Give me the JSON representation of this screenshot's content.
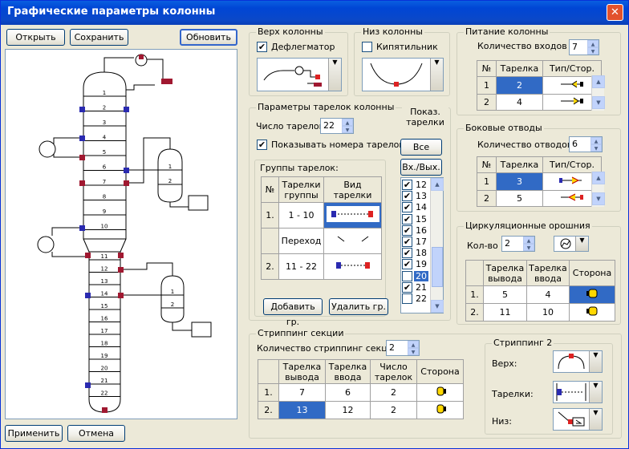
{
  "window": {
    "title": "Графические параметры колонны",
    "close": "✕"
  },
  "toolbar": {
    "open": "Открыть",
    "save": "Сохранить",
    "refresh": "Обновить"
  },
  "footer": {
    "apply": "Применить",
    "cancel": "Отмена"
  },
  "column_top": {
    "legend": "Верх колонны",
    "checkbox_label": "Дефлегматор",
    "checked": true
  },
  "column_bottom": {
    "legend": "Низ колонны",
    "checkbox_label": "Кипятильник",
    "checked": false
  },
  "feed": {
    "legend": "Питание колонны",
    "count_label": "Количество входов",
    "count": "7",
    "headers": [
      "№",
      "Тарелка",
      "Тип/Стор."
    ],
    "rows": [
      {
        "n": "1",
        "tray": "2"
      },
      {
        "n": "2",
        "tray": "4"
      }
    ]
  },
  "tray_params": {
    "legend": "Параметры тарелок колонны",
    "count_label": "Число тарелок",
    "count": "22",
    "show_numbers_label": "Показывать номера тарелок",
    "show_numbers": true,
    "groups_legend": "Группы тарелок:",
    "group_headers": [
      "№",
      "Тарелки группы",
      "Вид тарелки"
    ],
    "groups": [
      {
        "n": "1.",
        "trays": "1 - 10"
      },
      {
        "n": "",
        "trays": "Переход"
      },
      {
        "n": "2.",
        "trays": "11 - 22"
      }
    ],
    "add_group": "Добавить гр.",
    "delete_group": "Удалить гр."
  },
  "show_trays": {
    "label": "Показ. тарелки",
    "all": "Все",
    "in_out": "Вх./Вых.",
    "items": [
      {
        "n": "12",
        "c": true
      },
      {
        "n": "13",
        "c": true
      },
      {
        "n": "14",
        "c": true
      },
      {
        "n": "15",
        "c": true
      },
      {
        "n": "16",
        "c": true
      },
      {
        "n": "17",
        "c": true
      },
      {
        "n": "18",
        "c": true
      },
      {
        "n": "19",
        "c": true
      },
      {
        "n": "20",
        "c": false
      },
      {
        "n": "21",
        "c": true
      },
      {
        "n": "22",
        "c": false
      }
    ],
    "selected": "20"
  },
  "side_draws": {
    "legend": "Боковые отводы",
    "count_label": "Количество отводов",
    "count": "6",
    "headers": [
      "№",
      "Тарелка",
      "Тип/Стор."
    ],
    "rows": [
      {
        "n": "1",
        "tray": "3"
      },
      {
        "n": "2",
        "tray": "5"
      }
    ]
  },
  "pumparounds": {
    "legend": "Циркуляционные орошния",
    "count_label": "Кол-во",
    "count": "2",
    "headers": [
      "",
      "Тарелка вывода",
      "Тарелка ввода",
      "Сторона"
    ],
    "rows": [
      {
        "n": "1.",
        "out": "5",
        "in": "4"
      },
      {
        "n": "2.",
        "out": "11",
        "in": "10"
      }
    ]
  },
  "stripping": {
    "legend": "Стриппинг секции",
    "count_label": "Количество стриппинг секций",
    "count": "2",
    "headers": [
      "",
      "Тарелка вывода",
      "Тарелка ввода",
      "Число тарелок",
      "Сторона"
    ],
    "rows": [
      {
        "n": "1.",
        "out": "7",
        "in": "6",
        "trays": "2"
      },
      {
        "n": "2.",
        "out": "13",
        "in": "12",
        "trays": "2"
      }
    ]
  },
  "stripping2": {
    "legend": "Стриппинг 2",
    "top": "Верх:",
    "trays": "Тарелки:",
    "bottom": "Низ:"
  },
  "diagram": {
    "main_trays": [
      "1",
      "2",
      "3",
      "4",
      "5",
      "6",
      "7",
      "8",
      "9",
      "10"
    ],
    "lower_trays": [
      "11",
      "12",
      "13",
      "14",
      "15",
      "16",
      "17",
      "18",
      "19",
      "20",
      "21",
      "22"
    ],
    "strip_trays": [
      "1",
      "2"
    ]
  }
}
